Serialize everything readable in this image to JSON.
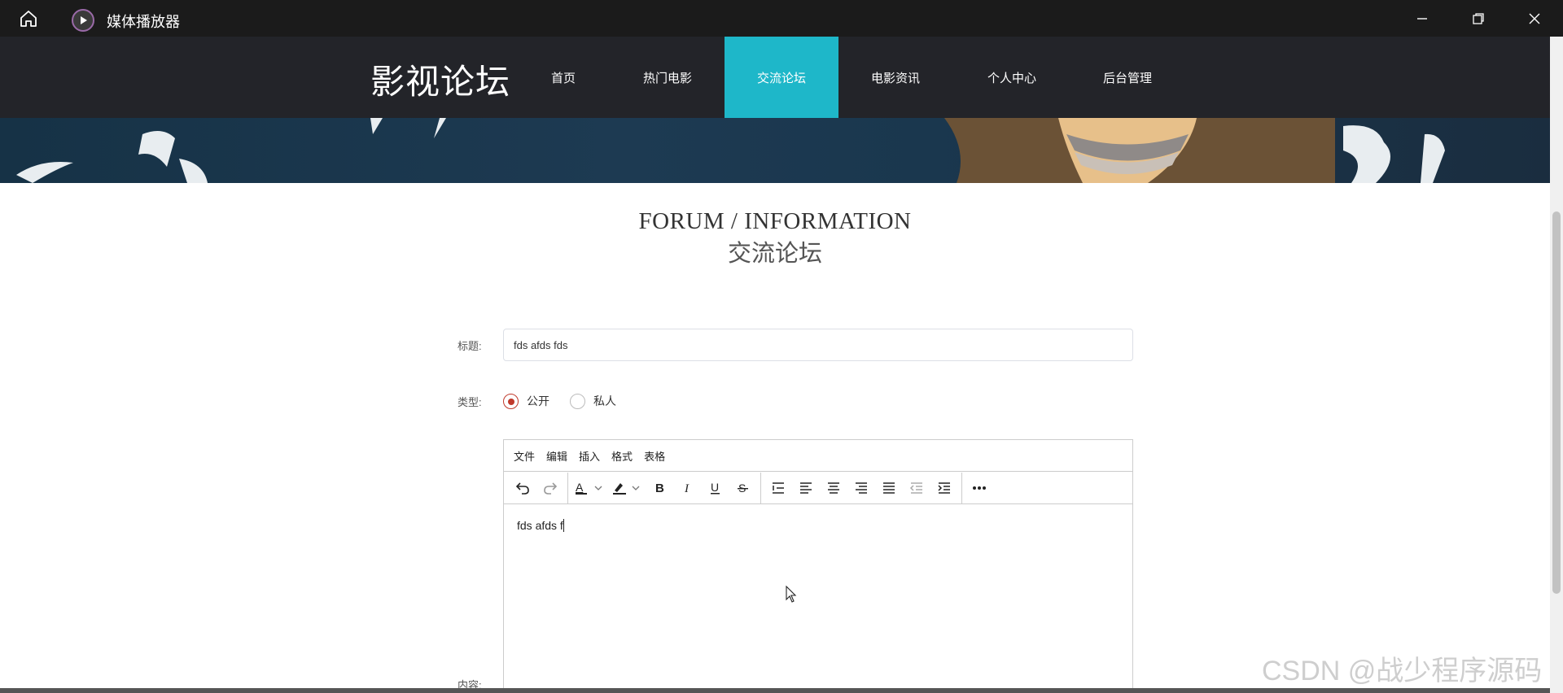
{
  "window": {
    "title": "媒体播放器"
  },
  "nav": {
    "brand": "影视论坛",
    "items": [
      {
        "label": "首页",
        "active": false
      },
      {
        "label": "热门电影",
        "active": false
      },
      {
        "label": "交流论坛",
        "active": true
      },
      {
        "label": "电影资讯",
        "active": false
      },
      {
        "label": "个人中心",
        "active": false
      },
      {
        "label": "后台管理",
        "active": false
      }
    ]
  },
  "section": {
    "title_en": "FORUM / INFORMATION",
    "title_cn": "交流论坛"
  },
  "form": {
    "title_label": "标题:",
    "title_value": "fds afds fds",
    "type_label": "类型:",
    "type_options": [
      {
        "label": "公开",
        "checked": true
      },
      {
        "label": "私人",
        "checked": false
      }
    ],
    "content_label": "内容:"
  },
  "editor": {
    "menu": [
      "文件",
      "编辑",
      "插入",
      "格式",
      "表格"
    ],
    "content_text": "fds afds f"
  },
  "watermark": "CSDN @战少程序源码",
  "colors": {
    "nav_bg": "#232429",
    "active": "#1eb7c9",
    "radio": "#c0392b",
    "titlebar": "#1b1b1b"
  }
}
